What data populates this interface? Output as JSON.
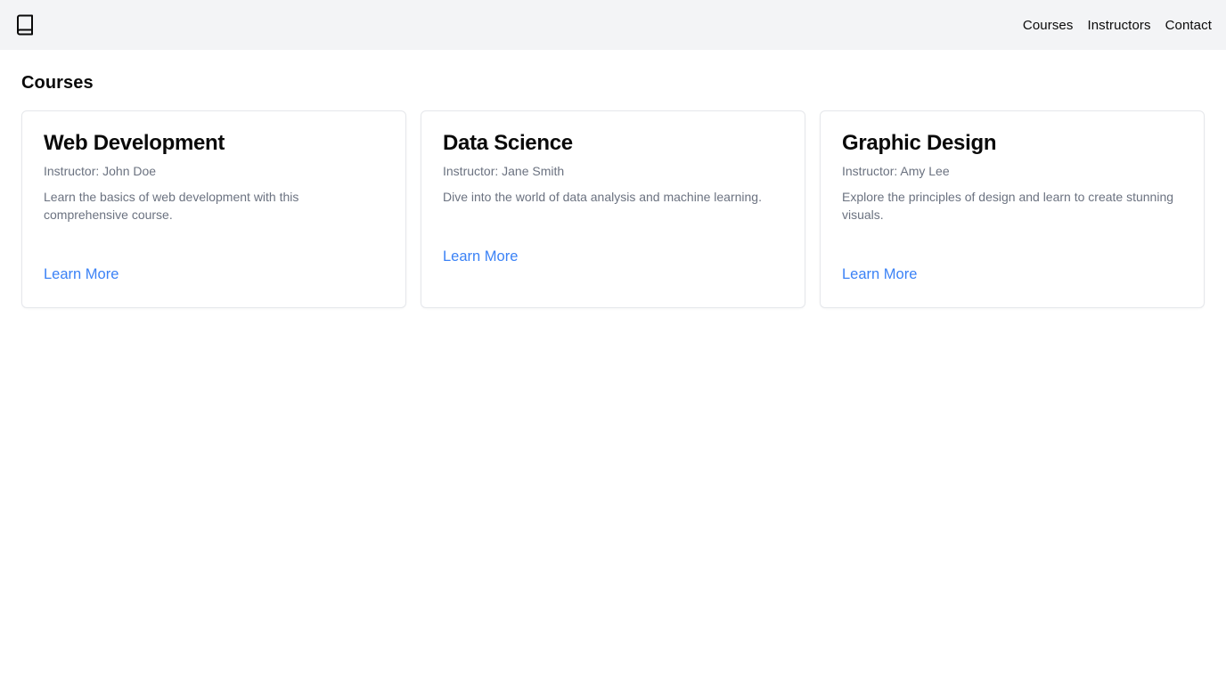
{
  "header": {
    "logo_icon": "book-icon",
    "nav": [
      {
        "label": "Courses"
      },
      {
        "label": "Instructors"
      },
      {
        "label": "Contact"
      }
    ]
  },
  "main": {
    "title": "Courses",
    "courses": [
      {
        "title": "Web Development",
        "instructor": "Instructor: John Doe",
        "description": "Learn the basics of web development with this comprehensive course.",
        "link_label": "Learn More"
      },
      {
        "title": "Data Science",
        "instructor": "Instructor: Jane Smith",
        "description": "Dive into the world of data analysis and machine learning.",
        "link_label": "Learn More"
      },
      {
        "title": "Graphic Design",
        "instructor": "Instructor: Amy Lee",
        "description": "Explore the principles of design and learn to create stunning visuals.",
        "link_label": "Learn More"
      }
    ]
  },
  "colors": {
    "header_bg": "#f3f4f6",
    "link": "#3b82f6",
    "muted_text": "#6b7280",
    "card_border": "#e5e7eb"
  }
}
